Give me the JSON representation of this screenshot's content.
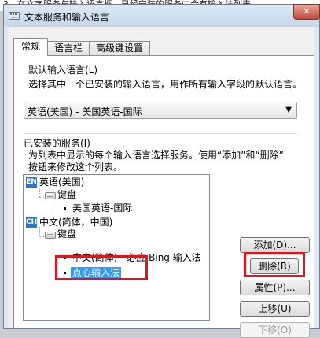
{
  "background_text": "3、在文字服务与输入语言框，已经安装的服务中会有输入法列表，",
  "window": {
    "title": "文本服务和输入语言",
    "close_label": "✕"
  },
  "tabs": [
    {
      "label": "常规",
      "active": true
    },
    {
      "label": "语言栏",
      "active": false
    },
    {
      "label": "高级键设置",
      "active": false
    }
  ],
  "default_lang": {
    "heading": "默认输入语言(L)",
    "description": "选择其中一个已安装的输入语言，用作所有输入字段的默认语言。",
    "selected": "英语(美国) - 美国英语-国际"
  },
  "services": {
    "heading": "已安装的服务(I)",
    "description_line1": "为列表中显示的每个输入语言选择服务。使用“添加”和“删除”",
    "description_line2": "按钮来修改这个列表。",
    "tree": {
      "en_badge": "EN",
      "en_lang": "英语(美国)",
      "en_keyboard": "键盘",
      "en_ime": "美国英语-国际",
      "ch_badge": "CH",
      "ch_lang": "中文(简体，中国)",
      "ch_keyboard": "键盘",
      "ch_ime1": "中文(简体) - 必应 Bing 输入法",
      "ch_ime2": "点心输入法"
    }
  },
  "buttons": {
    "add": "添加(D)...",
    "remove": "删除(R)",
    "properties": "属性(P)...",
    "move_up": "上移(U)",
    "move_down": "下移(O)"
  },
  "colors": {
    "highlight": "#e0141b",
    "selection": "#3399ff",
    "badge": "#2a78c8"
  }
}
